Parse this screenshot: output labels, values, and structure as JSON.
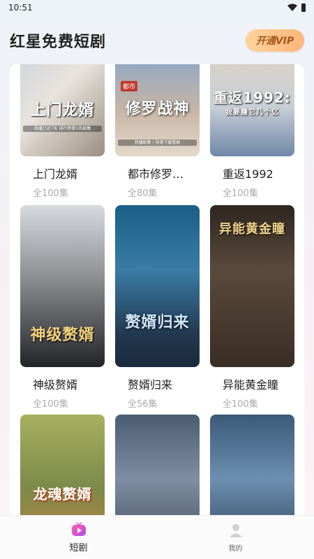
{
  "status_bar": {
    "time": "10:51"
  },
  "header": {
    "app_title": "红星免费短剧",
    "vip_button_label": "开通VIP"
  },
  "dramas": [
    {
      "title": "上门龙婿",
      "episodes": "全100集",
      "poster_text": "上门龙婿",
      "poster_sub": "热播已达7天 排行榜第1名剧集"
    },
    {
      "title": "都市修罗…",
      "episodes": "全80集",
      "poster_text": "修罗战神",
      "poster_badge": "都市",
      "poster_sub": "热播剧集 | 快速下载看剧"
    },
    {
      "title": "重返1992",
      "episodes": "全100集",
      "poster_text": "重返1992:",
      "poster_sub_text": "我要赚它几个亿"
    },
    {
      "title": "神级赘婿",
      "episodes": "全100集",
      "poster_text": "神级赘婿"
    },
    {
      "title": "赘婿归来",
      "episodes": "全56集",
      "poster_text": "赘婿归来"
    },
    {
      "title": "异能黄金瞳",
      "episodes": "全100集",
      "poster_text": "异能黄金瞳"
    },
    {
      "title": "",
      "episodes": "",
      "poster_text": "龙魂赘婿"
    },
    {
      "title": "",
      "episodes": "",
      "poster_text": ""
    },
    {
      "title": "",
      "episodes": "",
      "poster_text": ""
    }
  ],
  "tab_bar": {
    "tabs": [
      {
        "label": "短剧",
        "icon": "tv-icon",
        "active": true
      },
      {
        "label": "我的",
        "icon": "person-icon",
        "active": false
      }
    ]
  },
  "colors": {
    "accent": "#e14fd0",
    "vip_gold": "#ffb57a"
  }
}
